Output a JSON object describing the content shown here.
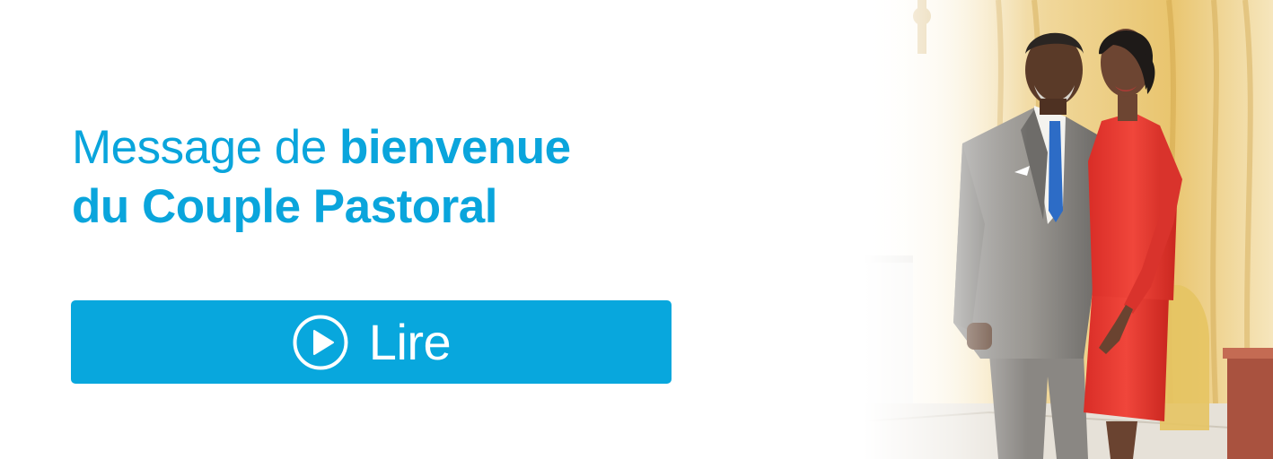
{
  "headline": {
    "part1": "Message de ",
    "part2": "bienvenue",
    "part3": "du Couple Pastoral"
  },
  "cta": {
    "label": "Lire",
    "icon": "play-circle-icon"
  },
  "colors": {
    "accent": "#08a7dd",
    "text_on_accent": "#ffffff"
  },
  "photo": {
    "subject": "pastoral-couple-photo"
  }
}
